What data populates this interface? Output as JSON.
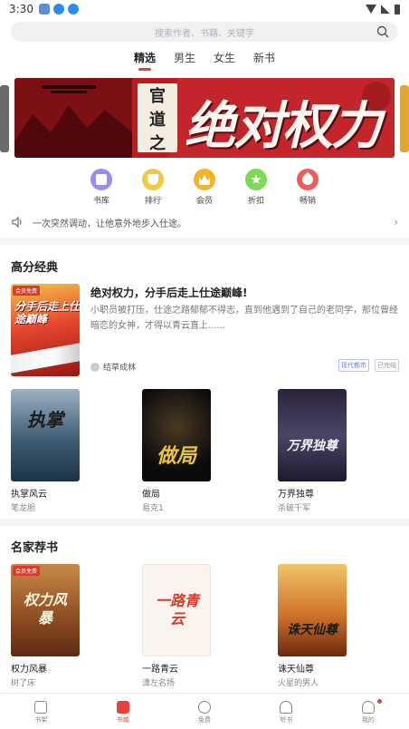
{
  "status_bar": {
    "time": "3:30"
  },
  "search": {
    "placeholder": "搜索作者、书籍、关键字"
  },
  "tabs": [
    {
      "label": "精选",
      "active": true
    },
    {
      "label": "男生",
      "active": false
    },
    {
      "label": "女生",
      "active": false
    },
    {
      "label": "新书",
      "active": false
    }
  ],
  "banner": {
    "sub_title": [
      "官",
      "道",
      "之"
    ],
    "title": "绝对权力"
  },
  "quick_nav": [
    {
      "label": "书库",
      "icon": "library-icon",
      "color": "#9b8cf0"
    },
    {
      "label": "排行",
      "icon": "trophy-icon",
      "color": "#f5c842"
    },
    {
      "label": "会员",
      "icon": "crown-icon",
      "color": "#f5b32a"
    },
    {
      "label": "折扣",
      "icon": "discount-star-icon",
      "color": "#7ed957"
    },
    {
      "label": "畅销",
      "icon": "flame-icon",
      "color": "#f45a5a"
    }
  ],
  "notice": {
    "text": "一次突然调动，让他意外地步入仕途。"
  },
  "section_high": {
    "title": "高分经典",
    "featured": {
      "cover_badge": "会员免费",
      "cover_text": "分手后走上仕途巅峰",
      "title": "绝对权力，分手后走上仕途巅峰!",
      "description": "小职员被打压，仕途之路郁郁不得志，直到他遇到了自己的老同学，那位曾经暗恋的女神，才得以青云直上......",
      "author": "结草成林",
      "tags": [
        "现代都市",
        "已完结"
      ]
    },
    "books": [
      {
        "name": "执掌风云",
        "author": "笔龙胆",
        "cover_text": "执掌"
      },
      {
        "name": "做局",
        "author": "易克1",
        "cover_text": "做局"
      },
      {
        "name": "万界独尊",
        "author": "杀破千军",
        "cover_text": "万界独尊"
      }
    ]
  },
  "section_famous": {
    "title": "名家荐书",
    "books": [
      {
        "name": "权力风暴",
        "author": "树了床",
        "cover_text": "权力风暴",
        "badge": "会员免费"
      },
      {
        "name": "一路青云",
        "author": "潇左名扬",
        "cover_text": "一路青云"
      },
      {
        "name": "诛天仙尊",
        "author": "火星的男人",
        "cover_text": "诛天仙尊"
      }
    ]
  },
  "bottom_nav": [
    {
      "label": "书架",
      "icon": "bookshelf-icon",
      "active": false
    },
    {
      "label": "书城",
      "icon": "bookstore-icon",
      "active": true
    },
    {
      "label": "免费",
      "icon": "free-icon",
      "active": false
    },
    {
      "label": "听书",
      "icon": "headphones-icon",
      "active": false
    },
    {
      "label": "我的",
      "icon": "profile-icon",
      "active": false
    }
  ]
}
